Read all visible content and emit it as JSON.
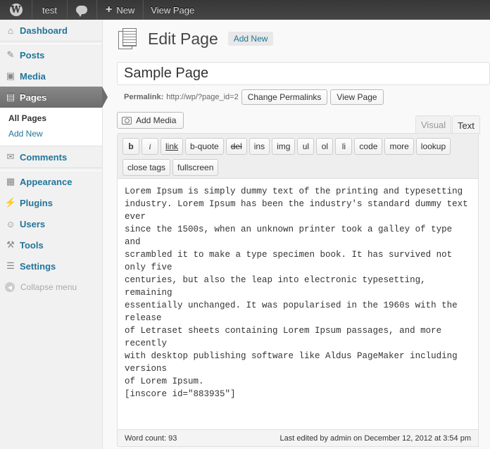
{
  "adminbar": {
    "site_name": "test",
    "new_label": "New",
    "view_page_label": "View Page"
  },
  "sidebar": {
    "items": [
      {
        "label": "Dashboard",
        "icon": "dashboard-icon"
      },
      {
        "label": "Posts",
        "icon": "pushpin-icon"
      },
      {
        "label": "Media",
        "icon": "media-icon"
      },
      {
        "label": "Pages",
        "icon": "pages-icon",
        "current": true
      },
      {
        "label": "Comments",
        "icon": "comment-icon"
      },
      {
        "label": "Appearance",
        "icon": "paintbrush-icon"
      },
      {
        "label": "Plugins",
        "icon": "plug-icon"
      },
      {
        "label": "Users",
        "icon": "users-icon"
      },
      {
        "label": "Tools",
        "icon": "tools-icon"
      },
      {
        "label": "Settings",
        "icon": "settings-icon"
      }
    ],
    "submenu": [
      "All Pages",
      "Add New"
    ],
    "collapse_label": "Collapse menu"
  },
  "main": {
    "title": "Edit Page",
    "add_new_label": "Add New",
    "post_title_value": "Sample Page",
    "permalink_label": "Permalink:",
    "permalink_url": "http://wp/?page_id=2",
    "change_permalinks_label": "Change Permalinks",
    "view_page_label": "View Page",
    "add_media_label": "Add Media",
    "tabs": {
      "visual": "Visual",
      "text": "Text"
    },
    "toolbar": [
      "b",
      "i",
      "link",
      "b-quote",
      "del",
      "ins",
      "img",
      "ul",
      "ol",
      "li",
      "code",
      "more",
      "lookup",
      "close tags",
      "fullscreen"
    ],
    "content": "Lorem Ipsum is simply dummy text of the printing and typesetting\nindustry. Lorem Ipsum has been the industry's standard dummy text ever\nsince the 1500s, when an unknown printer took a galley of type and\nscrambled it to make a type specimen book. It has survived not only five\ncenturies, but also the leap into electronic typesetting, remaining\nessentially unchanged. It was popularised in the 1960s with the release\nof Letraset sheets containing Lorem Ipsum passages, and more recently\nwith desktop publishing software like Aldus PageMaker including versions\nof Lorem Ipsum.\n[inscore id=\"883935\"]",
    "word_count": "Word count: 93",
    "last_edited": "Last edited by admin on December 12, 2012 at 3:54 pm"
  }
}
